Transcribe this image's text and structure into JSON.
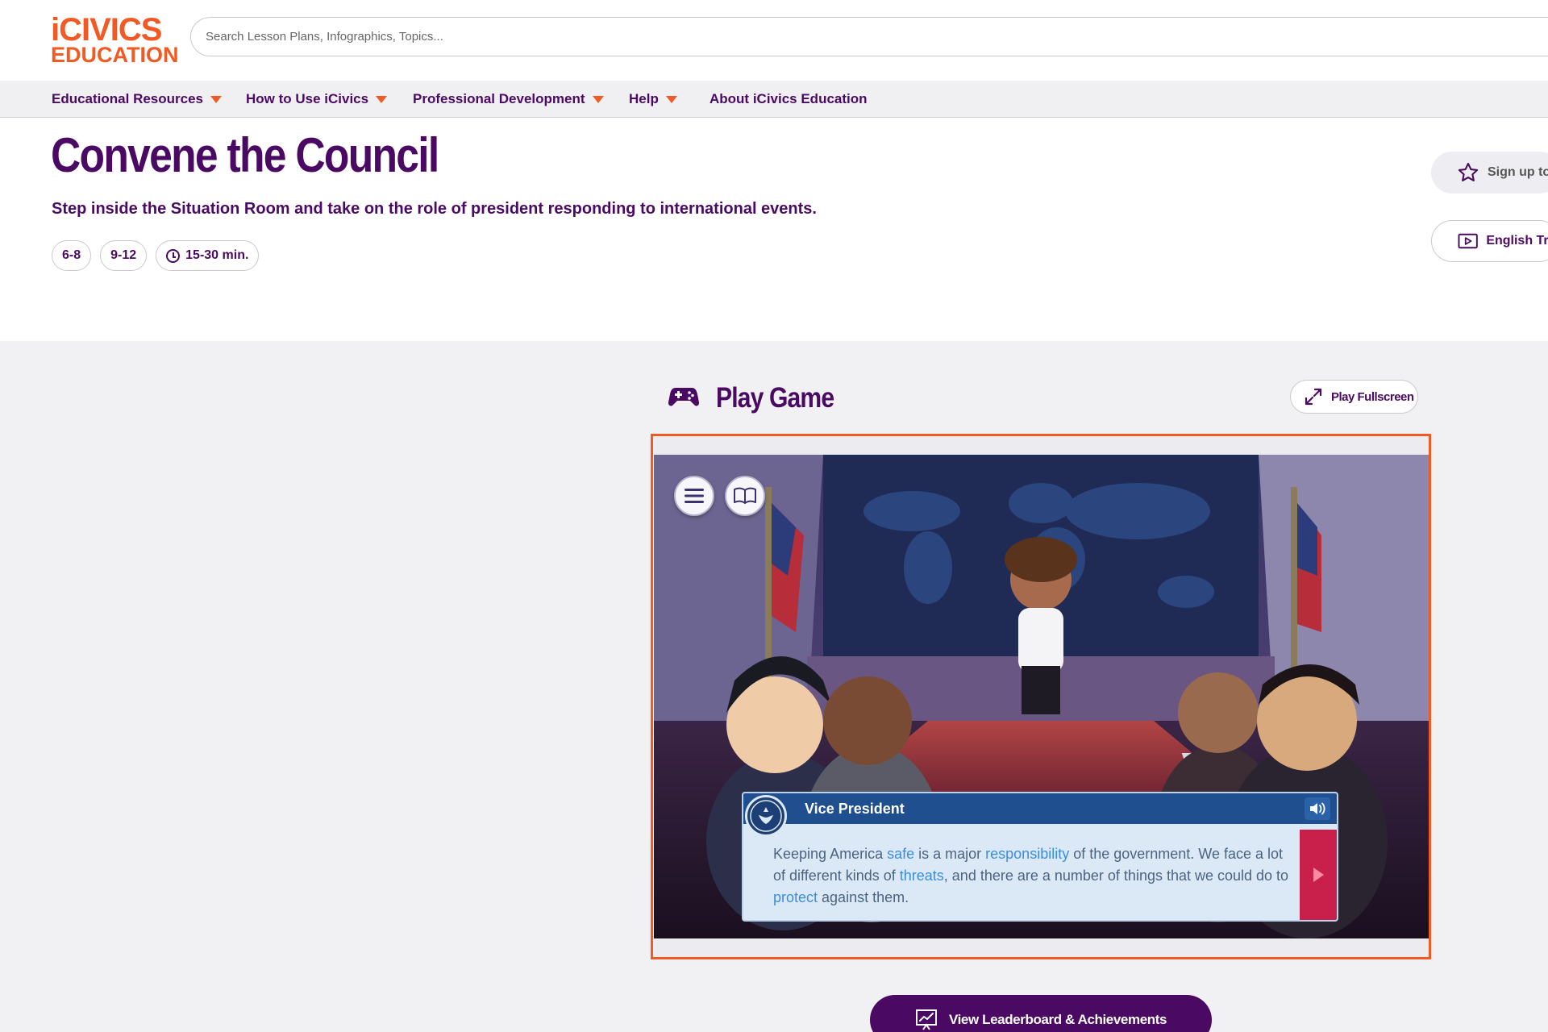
{
  "logo": {
    "line1": "iCIVICS",
    "line2": "EDUCATION"
  },
  "search": {
    "placeholder": "Search Lesson Plans, Infographics, Topics..."
  },
  "nav": {
    "items": [
      {
        "label": "Educational Resources",
        "has_caret": true
      },
      {
        "label": "How to Use iCivics",
        "has_caret": true
      },
      {
        "label": "Professional Development",
        "has_caret": true
      },
      {
        "label": "Help",
        "has_caret": true
      },
      {
        "label": "About iCivics Education",
        "has_caret": false
      }
    ]
  },
  "hero": {
    "title": "Convene the Council",
    "subtitle": "Step inside the Situation Room and take on the role of president responding to international events.",
    "pills": [
      "6-8",
      "9-12",
      "15-30 min."
    ]
  },
  "side_actions": {
    "signup_label": "Sign up to",
    "trailer_label": "English Trai"
  },
  "game": {
    "section_title": "Play Game",
    "fullscreen_label": "Play Fullscreen",
    "dialog": {
      "speaker": "Vice President",
      "text_parts": [
        {
          "t": "Keeping America ",
          "hl": false
        },
        {
          "t": "safe",
          "hl": true
        },
        {
          "t": " is a major ",
          "hl": false
        },
        {
          "t": "responsibility",
          "hl": true
        },
        {
          "t": " of the government. We face a lot of different kinds of ",
          "hl": false
        },
        {
          "t": "threats",
          "hl": true
        },
        {
          "t": ", and there are a number of things that we could do to ",
          "hl": false
        },
        {
          "t": "protect",
          "hl": true
        },
        {
          "t": " against them.",
          "hl": false
        }
      ]
    },
    "leaderboard_label": "View Leaderboard & Achievements"
  },
  "colors": {
    "brand_purple": "#4a0a63",
    "accent_orange": "#f15a24",
    "dialog_header": "#1f4f8f",
    "dialog_next": "#c8204a",
    "highlight_blue": "#3b8ddb"
  },
  "icons": [
    "search-icon",
    "chevron-down-icon",
    "clock-icon",
    "star-icon",
    "play-video-icon",
    "gamepad-icon",
    "expand-icon",
    "menu-icon",
    "book-icon",
    "speaker-icon",
    "arrow-right-icon",
    "chart-icon"
  ]
}
